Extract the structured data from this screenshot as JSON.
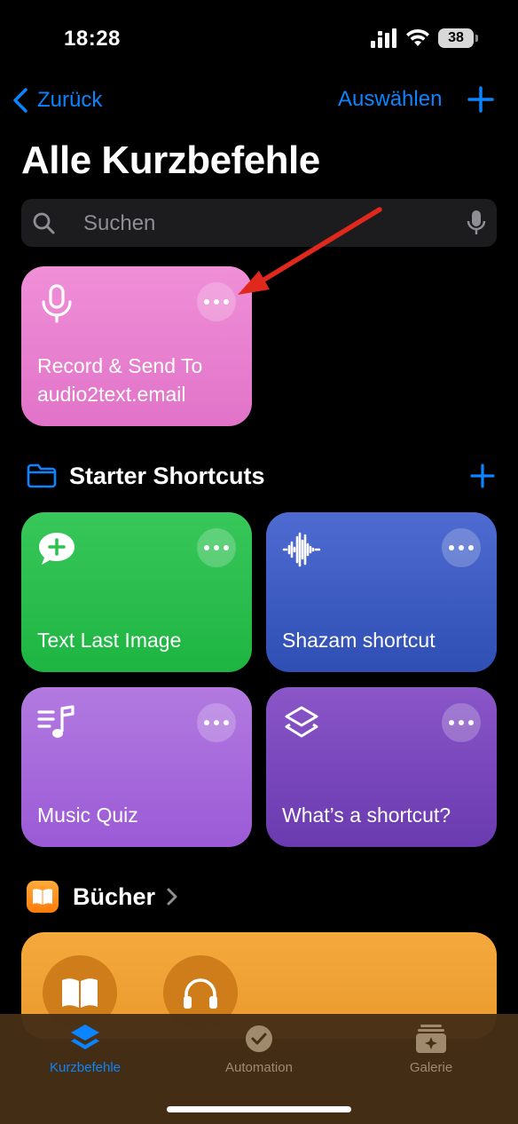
{
  "status_bar": {
    "time": "18:28",
    "battery": "38"
  },
  "nav": {
    "back_label": "Zurück",
    "select_label": "Auswählen"
  },
  "page": {
    "title": "Alle Kurzbefehle"
  },
  "search": {
    "placeholder": "Suchen"
  },
  "shortcuts": {
    "record": {
      "label": "Record & Send To audio2text.email",
      "icon": "microphone-icon"
    }
  },
  "sections": {
    "starter": {
      "title": "Starter Shortcuts",
      "items": [
        {
          "label": "Text Last Image",
          "icon": "message-plus-icon",
          "color": "#2fc14f"
        },
        {
          "label": "Shazam shortcut",
          "icon": "waveform-icon",
          "color": "#3d5cc3"
        },
        {
          "label": "Music Quiz",
          "icon": "music-list-icon",
          "color": "#a86bdc"
        },
        {
          "label": "What’s a shortcut?",
          "icon": "shortcuts-layers-icon",
          "color": "#7b48bd"
        }
      ]
    },
    "books": {
      "title": "Bücher"
    }
  },
  "tabbar": {
    "tabs": [
      {
        "label": "Kurzbefehle",
        "active": true
      },
      {
        "label": "Automation",
        "active": false
      },
      {
        "label": "Galerie",
        "active": false
      }
    ]
  },
  "colors": {
    "accent": "#0a84ff",
    "annotation_arrow": "#e0281c"
  }
}
